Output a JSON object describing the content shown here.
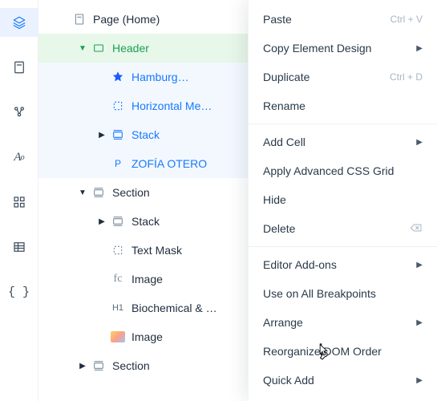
{
  "rail": {
    "items": [
      {
        "name": "layers",
        "active": true
      },
      {
        "name": "page"
      },
      {
        "name": "components"
      },
      {
        "name": "typography"
      },
      {
        "name": "grid"
      },
      {
        "name": "table"
      },
      {
        "name": "code"
      }
    ]
  },
  "tree": {
    "page_label": "Page (Home)",
    "header": {
      "label": "Header",
      "hamburger": "Hamburg…",
      "hmenu": "Horizontal Me…",
      "stack": "Stack",
      "text": "ZOFÍA OTERO"
    },
    "section1": {
      "label": "Section",
      "stack": "Stack",
      "textmask": "Text Mask",
      "image1": "Image",
      "h1": "Biochemical & …",
      "image2": "Image"
    },
    "section2": {
      "label": "Section"
    }
  },
  "menu": {
    "paste": "Paste",
    "paste_short": "Ctrl + V",
    "copy_design": "Copy Element Design",
    "duplicate": "Duplicate",
    "duplicate_short": "Ctrl + D",
    "rename": "Rename",
    "add_cell": "Add Cell",
    "apply_grid": "Apply Advanced CSS Grid",
    "hide": "Hide",
    "delete": "Delete",
    "addons": "Editor Add-ons",
    "breakpoints": "Use on All Breakpoints",
    "arrange": "Arrange",
    "reorganize": "Reorganize DOM Order",
    "quick_add": "Quick Add"
  }
}
